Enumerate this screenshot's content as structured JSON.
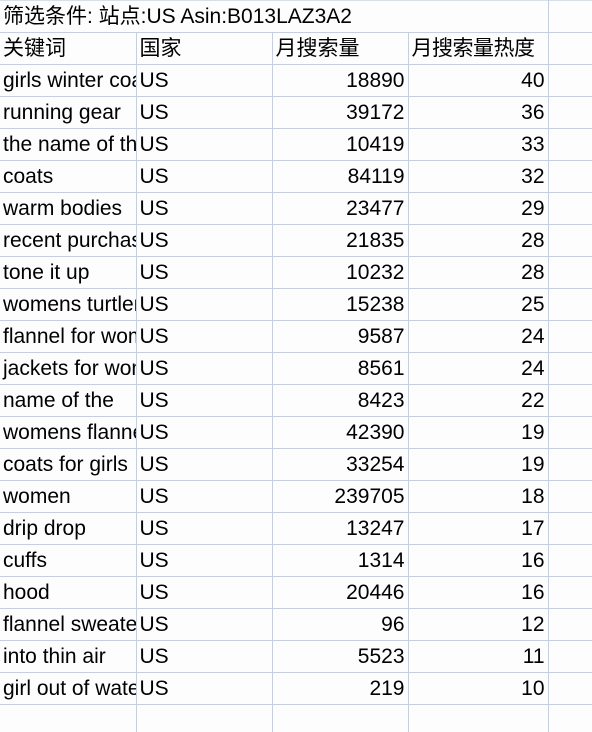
{
  "sheet": {
    "title_banner": "筛选条件: 站点:US Asin:B013LAZ3A2",
    "columns": [
      {
        "key": "keyword",
        "header": "关键词"
      },
      {
        "key": "country",
        "header": "国家"
      },
      {
        "key": "monthly_search_volume",
        "header": "月搜索量"
      },
      {
        "key": "monthly_search_heat",
        "header": "月搜索量热度"
      },
      {
        "key": "extra",
        "header": ""
      }
    ],
    "rows": [
      {
        "keyword": "girls winter coat",
        "country": "US",
        "monthly_search_volume": "18890",
        "monthly_search_heat": "40"
      },
      {
        "keyword": "running gear",
        "country": "US",
        "monthly_search_volume": "39172",
        "monthly_search_heat": "36"
      },
      {
        "keyword": "the name of the",
        "country": "US",
        "monthly_search_volume": "10419",
        "monthly_search_heat": "33"
      },
      {
        "keyword": "coats",
        "country": "US",
        "monthly_search_volume": "84119",
        "monthly_search_heat": "32"
      },
      {
        "keyword": "warm bodies",
        "country": "US",
        "monthly_search_volume": "23477",
        "monthly_search_heat": "29"
      },
      {
        "keyword": "recent purchases",
        "country": "US",
        "monthly_search_volume": "21835",
        "monthly_search_heat": "28"
      },
      {
        "keyword": "tone it up",
        "country": "US",
        "monthly_search_volume": "10232",
        "monthly_search_heat": "28"
      },
      {
        "keyword": "womens turtleneck",
        "country": "US",
        "monthly_search_volume": "15238",
        "monthly_search_heat": "25"
      },
      {
        "keyword": "flannel for women",
        "country": "US",
        "monthly_search_volume": "9587",
        "monthly_search_heat": "24"
      },
      {
        "keyword": "jackets for women",
        "country": "US",
        "monthly_search_volume": "8561",
        "monthly_search_heat": "24"
      },
      {
        "keyword": "name of the",
        "country": "US",
        "monthly_search_volume": "8423",
        "monthly_search_heat": "22"
      },
      {
        "keyword": "womens flannel",
        "country": "US",
        "monthly_search_volume": "42390",
        "monthly_search_heat": "19"
      },
      {
        "keyword": "coats for girls",
        "country": "US",
        "monthly_search_volume": "33254",
        "monthly_search_heat": "19"
      },
      {
        "keyword": "women",
        "country": "US",
        "monthly_search_volume": "239705",
        "monthly_search_heat": "18"
      },
      {
        "keyword": "drip drop",
        "country": "US",
        "monthly_search_volume": "13247",
        "monthly_search_heat": "17"
      },
      {
        "keyword": "cuffs",
        "country": "US",
        "monthly_search_volume": "1314",
        "monthly_search_heat": "16"
      },
      {
        "keyword": "hood",
        "country": "US",
        "monthly_search_volume": "20446",
        "monthly_search_heat": "16"
      },
      {
        "keyword": "flannel sweater",
        "country": "US",
        "monthly_search_volume": "96",
        "monthly_search_heat": "12"
      },
      {
        "keyword": "into thin air",
        "country": "US",
        "monthly_search_volume": "5523",
        "monthly_search_heat": "11"
      },
      {
        "keyword": "girl out of water",
        "country": "US",
        "monthly_search_volume": "219",
        "monthly_search_heat": "10"
      }
    ],
    "trailing_blank_rows": 1,
    "colors": {
      "gridline": "#c6cfe0",
      "cell_background": "#fdfdfd",
      "text": "#000000"
    }
  }
}
